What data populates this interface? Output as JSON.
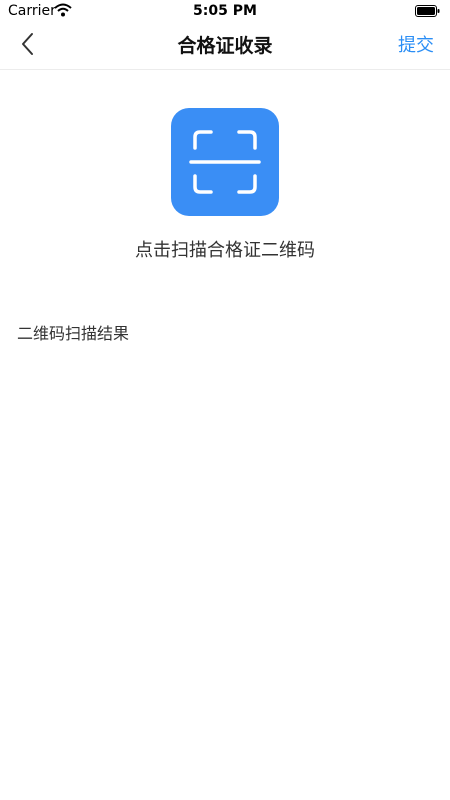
{
  "status_bar": {
    "carrier": "Carrier",
    "time": "5:05 PM",
    "icons": [
      "wifi-icon",
      "battery-icon"
    ]
  },
  "nav": {
    "back_icon": "chevron-left-icon",
    "title": "合格证收录",
    "submit_label": "提交"
  },
  "scan": {
    "icon": "qr-scan-icon",
    "caption": "点击扫描合格证二维码"
  },
  "result": {
    "label": "二维码扫描结果",
    "value": ""
  },
  "colors": {
    "accent": "#2b8ef5",
    "scan_tile": "#3a8ef5",
    "text": "#333333",
    "background": "#ffffff"
  }
}
